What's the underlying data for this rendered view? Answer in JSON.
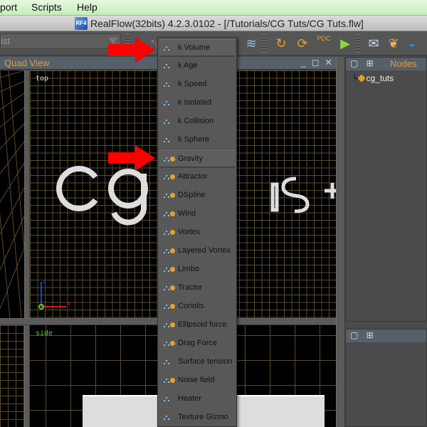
{
  "menubar": {
    "items": [
      "port",
      "Scripts",
      "Help"
    ]
  },
  "window": {
    "title": "RealFlow(32bits) 4.2.3.0102 - [/Tutorials/CG Tuts/CG Tuts.flw]",
    "app_icon": "RF4"
  },
  "toolbar": {
    "combo_value": "ist",
    "icons": [
      "resize-icon",
      "wave-icon",
      "emitter-run-icon",
      "recycle-run-icon",
      "pdc-icon",
      "run-icon",
      "message-run-icon",
      "scroll-icon",
      "ocean-icon"
    ],
    "pdc_label": "PDC"
  },
  "quad_view": {
    "title": "Quad View",
    "controls": "_ ◻ ✕",
    "viewports": {
      "top_label": "top",
      "side_label": "side"
    },
    "axis": {
      "x": "x",
      "z": "z"
    }
  },
  "nodes_panel": {
    "title": "Nodes",
    "items": [
      {
        "label": "cg_tuts"
      }
    ]
  },
  "daemon_menu": {
    "items": [
      {
        "label": "k Volume",
        "icons": [
          "blue"
        ]
      },
      {
        "label": "k Age",
        "icons": [
          "blue"
        ]
      },
      {
        "label": "k Speed",
        "icons": [
          "blue"
        ]
      },
      {
        "label": "k Isolated",
        "icons": [
          "blue"
        ]
      },
      {
        "label": "k Collision",
        "icons": [
          "blue"
        ]
      },
      {
        "label": "k Sphere",
        "icons": [
          "blue"
        ]
      },
      {
        "label": "Gravity",
        "icons": [
          "blue",
          "orange"
        ]
      },
      {
        "label": "Attractor",
        "icons": [
          "blue",
          "orange"
        ]
      },
      {
        "label": "DSpline",
        "icons": [
          "blue",
          "orange"
        ]
      },
      {
        "label": "Wind",
        "icons": [
          "blue",
          "orange"
        ]
      },
      {
        "label": "Vortex",
        "icons": [
          "blue",
          "orange"
        ]
      },
      {
        "label": "Layered Vortex",
        "icons": [
          "blue",
          "orange"
        ]
      },
      {
        "label": "Limbo",
        "icons": [
          "blue",
          "orange"
        ]
      },
      {
        "label": "Tractor",
        "icons": [
          "blue",
          "orange"
        ]
      },
      {
        "label": "Coriolis",
        "icons": [
          "blue",
          "orange"
        ]
      },
      {
        "label": "Ellipsoid force",
        "icons": [
          "blue",
          "orange"
        ]
      },
      {
        "label": "Drag Force",
        "icons": [
          "blue",
          "orange"
        ]
      },
      {
        "label": "Surface tension",
        "icons": [
          "blue"
        ]
      },
      {
        "label": "Noise field",
        "icons": [
          "blue",
          "orange"
        ]
      },
      {
        "label": "Heater",
        "icons": [
          "blue"
        ]
      },
      {
        "label": "Texture Gizmo",
        "icons": [
          "blue"
        ]
      }
    ],
    "highlighted": [
      "k Volume",
      "Gravity"
    ]
  },
  "annotations": {
    "arrow_color": "#ff0000",
    "arrow_targets": [
      "k Volume",
      "Gravity"
    ]
  },
  "colors": {
    "accent_orange": "#e79a2e",
    "panel_header": "#56606a",
    "grid": "#5a4a2e"
  },
  "scene_text": "cg tuts+"
}
